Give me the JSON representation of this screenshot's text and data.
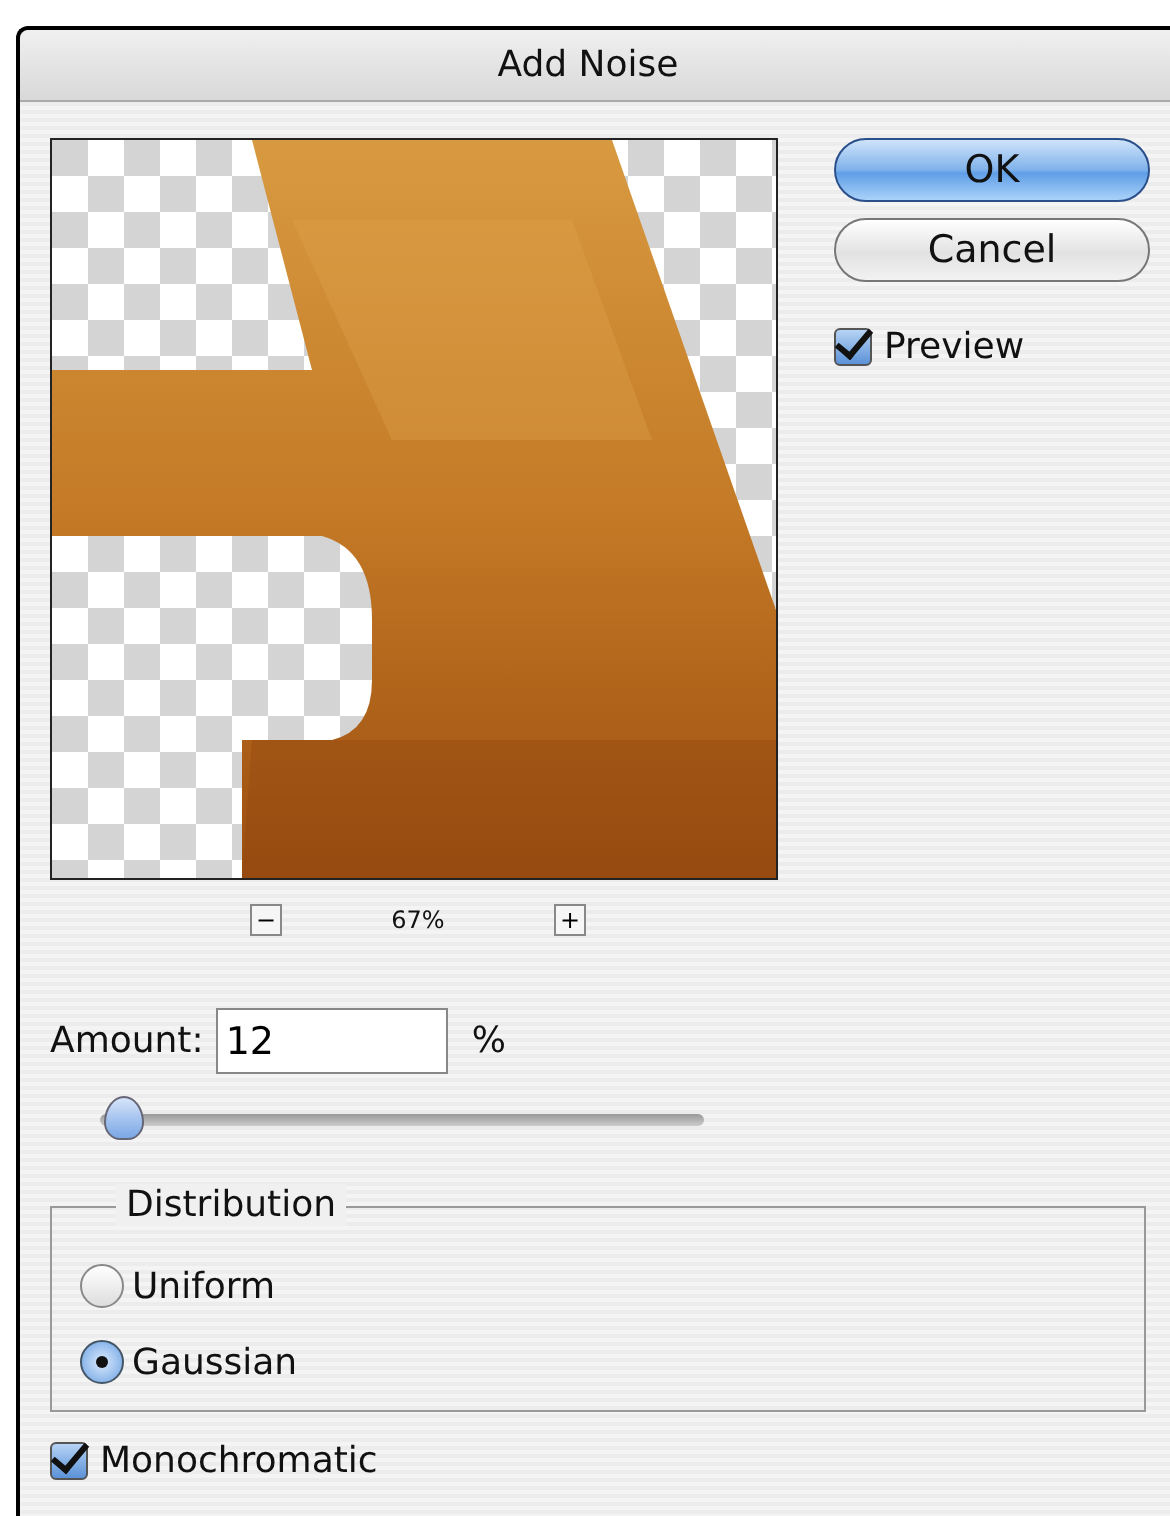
{
  "window": {
    "title": "Add Noise"
  },
  "preview": {
    "kind": "picture",
    "zoom_out": "−",
    "zoom": "67%",
    "zoom_in": "+"
  },
  "buttons": [
    {
      "label": "OK",
      "default": true
    },
    {
      "label": "Cancel",
      "default": false
    }
  ],
  "preview_option": {
    "label": "Preview",
    "checked": true
  },
  "amount": {
    "label": "Amount:",
    "value": "12",
    "unit": "%",
    "level": 0.04
  },
  "distribution": {
    "title": "Distribution",
    "options": [
      {
        "label": "Uniform",
        "selected": false
      },
      {
        "label": "Gaussian",
        "selected": true
      }
    ]
  },
  "monochromatic": {
    "label": "Monochromatic",
    "checked": true
  }
}
